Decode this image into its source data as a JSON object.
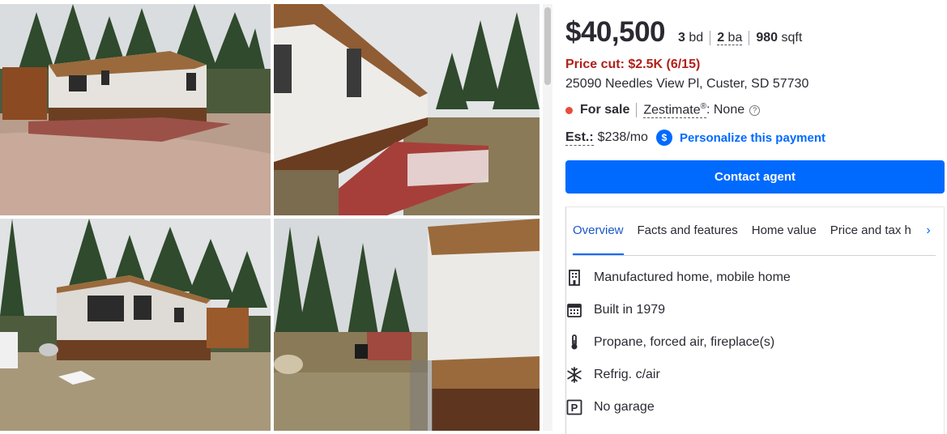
{
  "listing": {
    "price": "$40,500",
    "beds_value": "3",
    "beds_unit": "bd",
    "baths_value": "2",
    "baths_unit": "ba",
    "sqft_value": "980",
    "sqft_unit": "sqft",
    "price_cut": "Price cut: $2.5K (6/15)",
    "address": "25090 Needles View Pl, Custer, SD 57730",
    "status": "For sale",
    "zestimate_label": "Zestimate",
    "zestimate_mark": "®",
    "zestimate_value": ": None",
    "info_glyph": "?",
    "est_label": "Est.:",
    "est_value": "$238/mo",
    "dollar_glyph": "$",
    "personalize": "Personalize this payment",
    "contact_button": "Contact agent",
    "status_color": "#e84c3d",
    "price_cut_color": "#b1211b",
    "accent_color": "#006aff"
  },
  "tabs": [
    {
      "label": "Overview",
      "active": true
    },
    {
      "label": "Facts and features",
      "active": false
    },
    {
      "label": "Home value",
      "active": false
    },
    {
      "label": "Price and tax h",
      "active": false
    }
  ],
  "tab_next_glyph": "›",
  "features": [
    {
      "icon": "building-icon",
      "text": "Manufactured home, mobile home"
    },
    {
      "icon": "calendar-icon",
      "text": "Built in 1979"
    },
    {
      "icon": "thermometer-icon",
      "text": "Propane, forced air, fireplace(s)"
    },
    {
      "icon": "snowflake-icon",
      "text": "Refrig. c/air"
    },
    {
      "icon": "parking-icon",
      "text": "No garage"
    }
  ],
  "parking_glyph": "P",
  "photos": [
    {
      "name": "photo-mobile-home-front-driveway"
    },
    {
      "name": "photo-mobile-home-side-deck"
    },
    {
      "name": "photo-mobile-home-back-yard"
    },
    {
      "name": "photo-mobile-home-end-wall"
    }
  ]
}
